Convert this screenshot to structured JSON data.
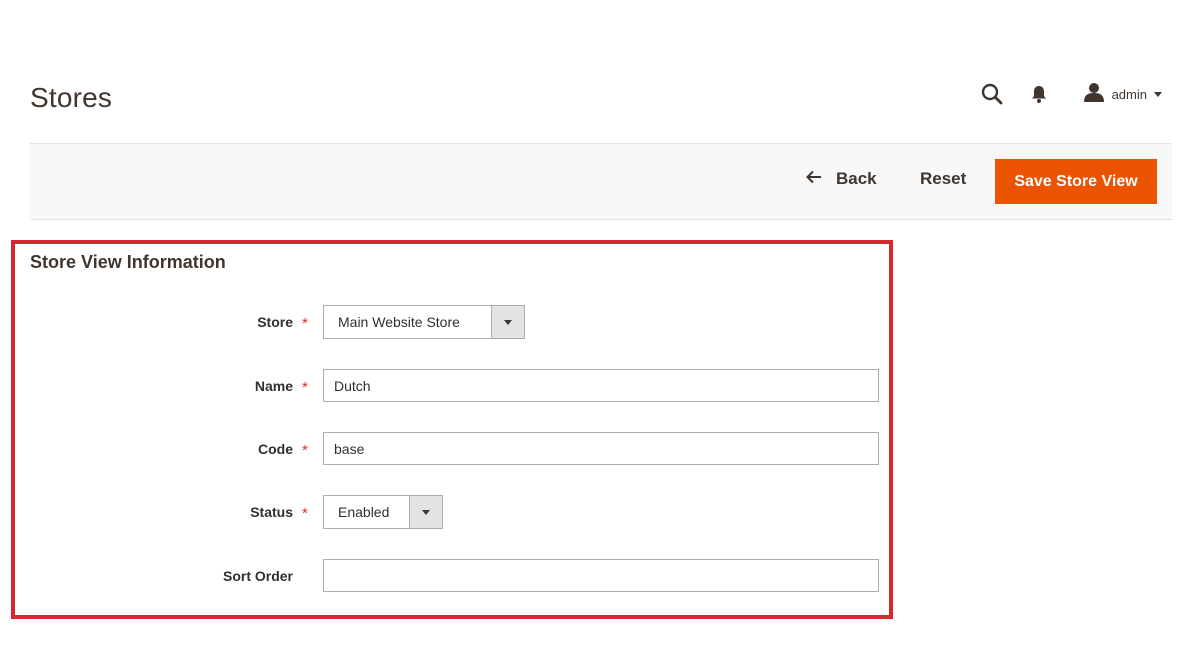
{
  "header": {
    "title": "Stores",
    "search_icon": "search-icon",
    "notifications_icon": "bell-icon",
    "user_icon": "user-icon",
    "user_label": "admin"
  },
  "action_bar": {
    "back_label": "Back",
    "reset_label": "Reset",
    "save_label": "Save Store View",
    "accent_color": "#eb5202"
  },
  "section": {
    "title": "Store View Information",
    "highlight_color": "#d7282f",
    "fields": {
      "store": {
        "label": "Store",
        "required": true,
        "value": "Main Website Store"
      },
      "name": {
        "label": "Name",
        "required": true,
        "value": "Dutch"
      },
      "code": {
        "label": "Code",
        "required": true,
        "value": "base"
      },
      "status": {
        "label": "Status",
        "required": true,
        "value": "Enabled"
      },
      "sort_order": {
        "label": "Sort Order",
        "required": false,
        "value": ""
      }
    },
    "required_marker": "*"
  }
}
